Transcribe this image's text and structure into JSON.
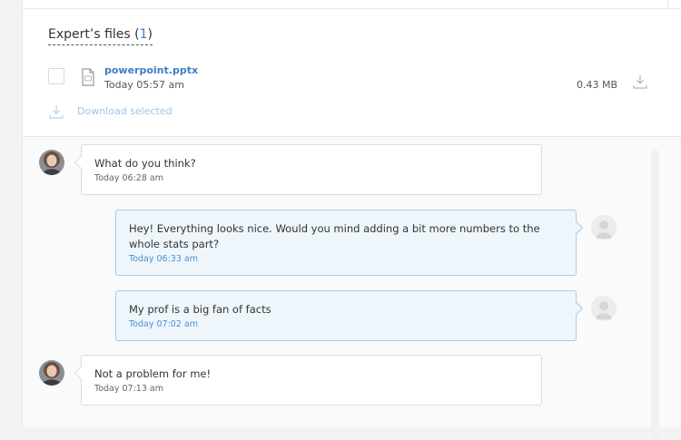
{
  "files": {
    "title": "Expert’s files",
    "count_open": "(",
    "count": "1",
    "count_close": ")",
    "items": [
      {
        "name": "powerpoint.pptx",
        "time": "Today 05:57 am",
        "size": "0.43 MB",
        "icon": "file-icon"
      }
    ],
    "download_selected": "Download selected"
  },
  "messages": [
    {
      "from": "expert",
      "text": "What do you think?",
      "time": "Today 06:28 am"
    },
    {
      "from": "me",
      "text": "Hey! Everything looks nice. Would you mind adding a bit more numbers to the whole stats part?",
      "time": "Today 06:33 am"
    },
    {
      "from": "me",
      "text": "My prof is a big fan of facts",
      "time": "Today 07:02 am"
    },
    {
      "from": "expert",
      "text": "Not a problem for me!",
      "time": "Today 07:13 am"
    }
  ],
  "colors": {
    "link": "#3a7fc4",
    "my_bubble_bg": "#eef6fc",
    "my_bubble_border": "#a9cce8"
  }
}
